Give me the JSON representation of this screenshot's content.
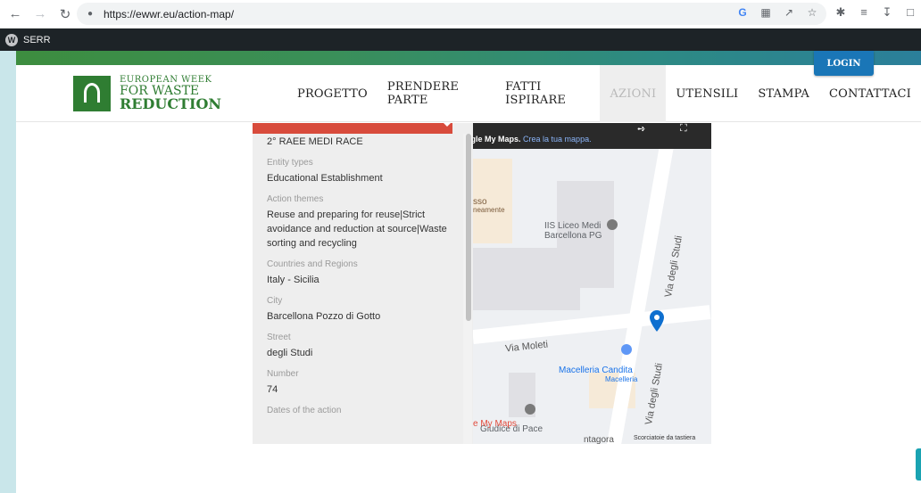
{
  "browser": {
    "url": "https://ewwr.eu/action-map/"
  },
  "adminbar": {
    "site_label": "SERR"
  },
  "header": {
    "logo_line1": "EUROPEAN WEEK",
    "logo_line2": "FOR WASTE",
    "logo_line3": "REDUCTION",
    "login_label": "LOGIN",
    "nav": [
      {
        "label": "PROGETTO"
      },
      {
        "label": "PRENDERE PARTE"
      },
      {
        "label": "FATTI ISPIRARE"
      },
      {
        "label": "AZIONI"
      },
      {
        "label": "UTENSILI"
      },
      {
        "label": "STAMPA"
      },
      {
        "label": "CONTATTACI"
      }
    ]
  },
  "map": {
    "credit_prefix": "ogle My Maps.",
    "credit_link": "Crea la tua mappa.",
    "keyboard_shortcuts": "Scorciatoie da tastiera",
    "mymaps_label": "e My Maps",
    "labels": {
      "school": "IIS Liceo Medi",
      "school2": "Barcellona PG",
      "partial": "sso",
      "partial2": "neamente",
      "butcher": "Macelleria Candita",
      "butcher2": "Macelleria",
      "giudice": "Giudice di Pace",
      "via_studi_1": "Via degli Studi",
      "via_studi_2": "Via degli Studi",
      "via_moleti": "Via Moleti",
      "tangora": "ntagora"
    }
  },
  "panel": {
    "name": "2° RAEE MEDI RACE",
    "fields": [
      {
        "label": "Entity types",
        "value": "Educational Establishment"
      },
      {
        "label": "Action themes",
        "value": "Reuse and preparing for reuse|Strict avoidance and reduction at source|Waste sorting and recycling"
      },
      {
        "label": "Countries and Regions",
        "value": "Italy - Sicilia"
      },
      {
        "label": "City",
        "value": "Barcellona Pozzo di Gotto"
      },
      {
        "label": "Street",
        "value": "degli Studi"
      },
      {
        "label": "Number",
        "value": "74"
      },
      {
        "label": "Dates of the action",
        "value": ""
      }
    ]
  },
  "colors": {
    "login_bg": "#1a76b7",
    "panel_header": "#d84b3c",
    "brand_green": "#2f7d32"
  }
}
